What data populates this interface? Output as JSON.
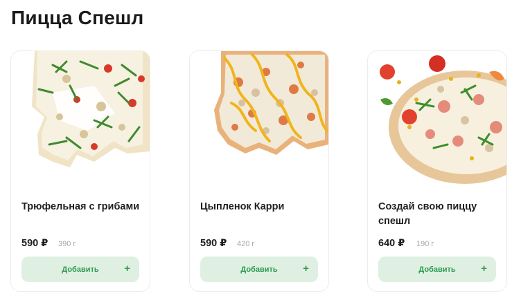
{
  "page": {
    "title": "Пицца Спешл"
  },
  "products": [
    {
      "title": "Трюфельная с грибами",
      "price": "590 ₽",
      "weight": "390 г",
      "add_label": "Добавить",
      "add_icon": "plus-icon",
      "image": "pizza-truffle-mushrooms"
    },
    {
      "title": "Цыпленок Карри",
      "price": "590 ₽",
      "weight": "420 г",
      "add_label": "Добавить",
      "add_icon": "plus-icon",
      "image": "pizza-chicken-curry"
    },
    {
      "title": "Создай свою пиццу спешл",
      "price": "640 ₽",
      "weight": "190 г",
      "add_label": "Добавить",
      "add_icon": "plus-icon",
      "image": "pizza-build-your-own"
    }
  ],
  "colors": {
    "accent": "#2a9a4c",
    "button_bg": "#dff0e3",
    "muted": "#a8a8a8"
  }
}
